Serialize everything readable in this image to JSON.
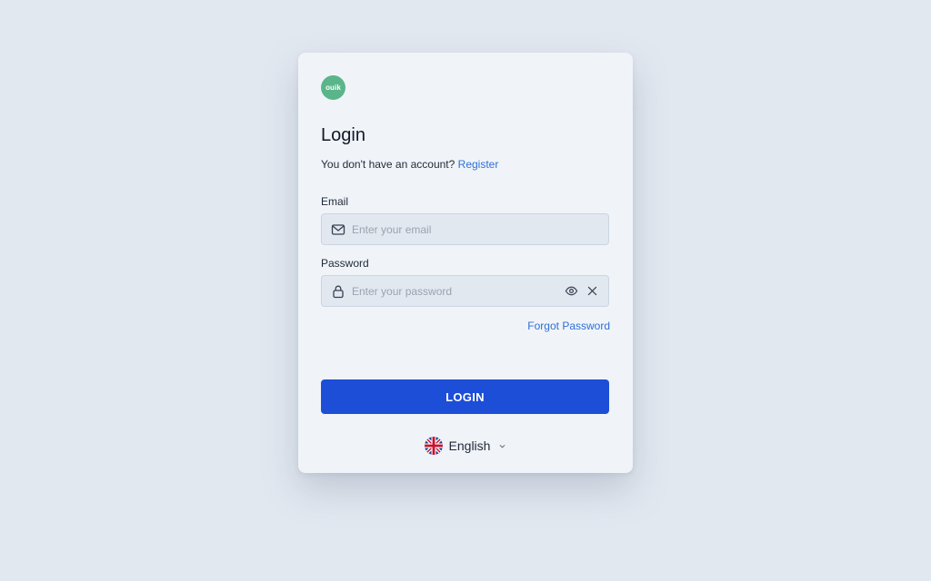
{
  "brand": {
    "logo_text": "ouik",
    "logo_color": "#5bb58b"
  },
  "login": {
    "title": "Login",
    "no_account_text": "You don't have an account?",
    "register_link": "Register",
    "email_label": "Email",
    "email_placeholder": "Enter your email",
    "email_value": "",
    "password_label": "Password",
    "password_placeholder": "Enter your password",
    "password_value": "",
    "forgot_link": "Forgot Password",
    "submit_label": "LOGIN",
    "accent_color": "#1d4ed8"
  },
  "language": {
    "selected": "English",
    "flag_icon": "uk-flag-icon"
  },
  "icons": {
    "email": "mail-icon",
    "password": "lock-icon",
    "reveal": "eye-icon",
    "clear": "close-icon",
    "dropdown": "chevron-down-icon"
  }
}
